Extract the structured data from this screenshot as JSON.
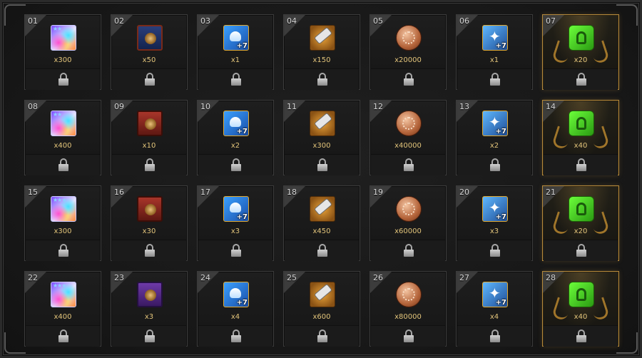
{
  "grid": {
    "rows": [
      [
        {
          "num": "01",
          "qty": "x300",
          "icon": "rainbow-crystal-2star-icon",
          "type": "crystal",
          "stars": "★★"
        },
        {
          "num": "02",
          "qty": "x50",
          "icon": "blue-tome-icon",
          "type": "book",
          "variant": "blue"
        },
        {
          "num": "03",
          "qty": "x1",
          "icon": "blue-stone-scroll-plus7-icon",
          "type": "scroll",
          "badge": "+7"
        },
        {
          "num": "04",
          "qty": "x150",
          "icon": "hammer-icon",
          "type": "hammer"
        },
        {
          "num": "05",
          "qty": "x20000",
          "icon": "bronze-coin-icon",
          "type": "coin"
        },
        {
          "num": "06",
          "qty": "x1",
          "icon": "blue-star-scroll-plus7-icon",
          "type": "star",
          "badge": "+7"
        },
        {
          "num": "07",
          "qty": "x20",
          "icon": "green-tablet-icon",
          "type": "green",
          "special": true
        }
      ],
      [
        {
          "num": "08",
          "qty": "x400",
          "icon": "rainbow-crystal-2star-icon",
          "type": "crystal",
          "stars": "★★"
        },
        {
          "num": "09",
          "qty": "x10",
          "icon": "red-tome-icon",
          "type": "book",
          "variant": "red"
        },
        {
          "num": "10",
          "qty": "x2",
          "icon": "blue-stone-scroll-plus7-icon",
          "type": "scroll",
          "badge": "+7"
        },
        {
          "num": "11",
          "qty": "x300",
          "icon": "hammer-icon",
          "type": "hammer"
        },
        {
          "num": "12",
          "qty": "x40000",
          "icon": "bronze-coin-icon",
          "type": "coin"
        },
        {
          "num": "13",
          "qty": "x2",
          "icon": "blue-star-scroll-plus7-icon",
          "type": "star",
          "badge": "+7"
        },
        {
          "num": "14",
          "qty": "x40",
          "icon": "green-tablet-icon",
          "type": "green",
          "special": true
        }
      ],
      [
        {
          "num": "15",
          "qty": "x300",
          "icon": "rainbow-crystal-3star-icon",
          "type": "crystal",
          "stars": "★★★"
        },
        {
          "num": "16",
          "qty": "x30",
          "icon": "red-tome-icon",
          "type": "book",
          "variant": "red"
        },
        {
          "num": "17",
          "qty": "x3",
          "icon": "blue-stone-scroll-plus7-icon",
          "type": "scroll",
          "badge": "+7"
        },
        {
          "num": "18",
          "qty": "x450",
          "icon": "hammer-icon",
          "type": "hammer"
        },
        {
          "num": "19",
          "qty": "x60000",
          "icon": "bronze-coin-icon",
          "type": "coin"
        },
        {
          "num": "20",
          "qty": "x3",
          "icon": "blue-star-scroll-plus7-icon",
          "type": "star",
          "badge": "+7"
        },
        {
          "num": "21",
          "qty": "x20",
          "icon": "green-tablet-icon",
          "type": "green",
          "special": true
        }
      ],
      [
        {
          "num": "22",
          "qty": "x400",
          "icon": "rainbow-crystal-3star-icon",
          "type": "crystal",
          "stars": "★★★"
        },
        {
          "num": "23",
          "qty": "x3",
          "icon": "purple-tome-icon",
          "type": "book",
          "variant": "purple"
        },
        {
          "num": "24",
          "qty": "x4",
          "icon": "blue-stone-scroll-plus7-icon",
          "type": "scroll",
          "badge": "+7"
        },
        {
          "num": "25",
          "qty": "x600",
          "icon": "hammer-icon",
          "type": "hammer"
        },
        {
          "num": "26",
          "qty": "x80000",
          "icon": "bronze-coin-icon",
          "type": "coin"
        },
        {
          "num": "27",
          "qty": "x4",
          "icon": "blue-star-scroll-plus7-icon",
          "type": "star",
          "badge": "+7"
        },
        {
          "num": "28",
          "qty": "x40",
          "icon": "green-tablet-icon",
          "type": "green",
          "special": true
        }
      ]
    ],
    "lock_icon": "padlock-icon",
    "colors": {
      "quantity": "#e2c47a",
      "special_border": "#b68a3c",
      "cell_border": "#3c3c3c"
    }
  }
}
